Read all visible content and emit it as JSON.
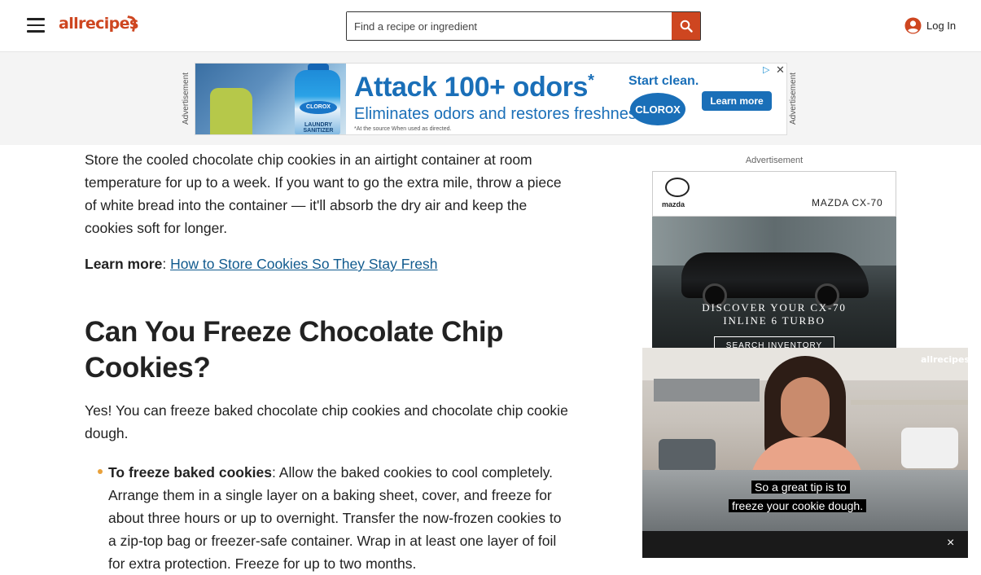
{
  "header": {
    "menu_icon": "hamburger-menu-icon",
    "logo_text": "allrecipes",
    "search_placeholder": "Find a recipe or ingredient",
    "search_icon": "search-icon",
    "login_label": "Log In",
    "account_icon": "account-circle-icon"
  },
  "top_ad": {
    "label": "Advertisement",
    "headline": "Attack 100+ odors",
    "headline_mark": "*",
    "subline": "Eliminates odors and restores freshness.",
    "fine_print": "*At the source When used as directed.",
    "start_clean": "Start clean.",
    "brand": "CLOROX",
    "learn_more": "Learn more",
    "product_label": "CLOROX",
    "product_text": "LAUNDRY SANITIZER",
    "adchoices_icon": "adchoices-icon",
    "close_icon": "close-icon"
  },
  "article": {
    "para1": "Store the cooled chocolate chip cookies in an airtight container at room temperature for up to a week. If you want to go the extra mile, throw a piece of white bread into the container — it'll absorb the dry air and keep the cookies soft for longer.",
    "learn_label": "Learn more",
    "learn_sep": ":",
    "learn_link": "How to Store Cookies So They Stay Fresh",
    "heading": "Can You Freeze Chocolate Chip Cookies?",
    "para2": "Yes! You can freeze baked chocolate chip cookies and chocolate chip cookie dough.",
    "bullet_bold": "To freeze baked cookies",
    "bullet_text": ": Allow the baked cookies to cool completely. Arrange them in a single layer on a baking sheet, cover, and freeze for about three hours or up to overnight. Transfer the now-frozen cookies to a zip-top bag or freezer-safe container. Wrap in at least one layer of foil for extra protection. Freeze for up to two months."
  },
  "side_ad": {
    "label": "Advertisement",
    "brand": "mazda",
    "model": "MAZDA CX-70",
    "headline1": "DISCOVER YOUR CX-70",
    "headline2": "INLINE 6 TURBO",
    "cta": "SEARCH INVENTORY"
  },
  "video": {
    "logo": "allrecipes",
    "caption_line1": "So a great tip is to",
    "caption_line2": "freeze your cookie dough.",
    "close_label": "×"
  }
}
